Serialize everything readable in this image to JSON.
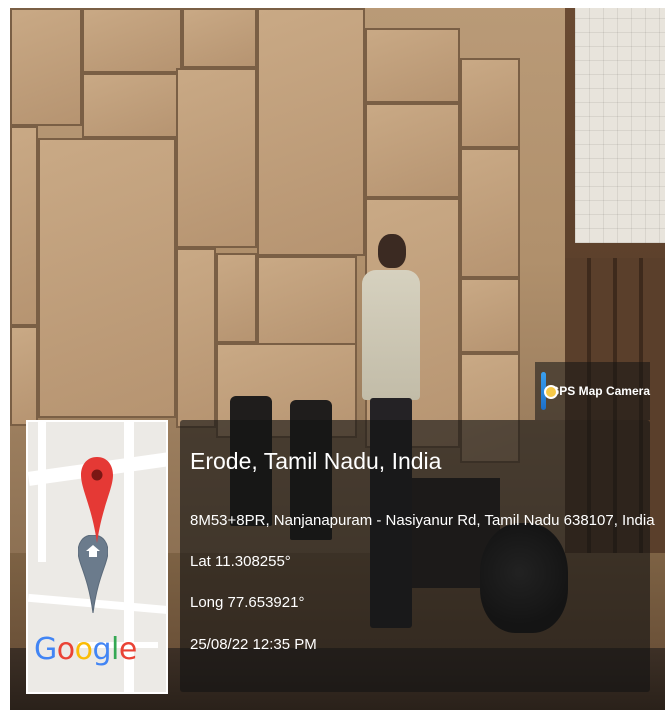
{
  "overlay": {
    "place_title": "Erode, Tamil Nadu, India",
    "address": "8M53+8PR, Nanjanapuram - Nasiyanur Rd, Tamil Nadu 638107, India",
    "latitude": "Lat 11.308255°",
    "longitude": "Long 77.653921°",
    "timestamp": "25/08/22 12:35 PM"
  },
  "badge": {
    "label": "GPS Map Camera",
    "icon": "gps-map-camera-app-icon"
  },
  "map": {
    "logo": {
      "letters": [
        "G",
        "o",
        "o",
        "g",
        "l",
        "e"
      ]
    },
    "pin_color": "#E53935",
    "marker_color": "#6B7B8C"
  }
}
